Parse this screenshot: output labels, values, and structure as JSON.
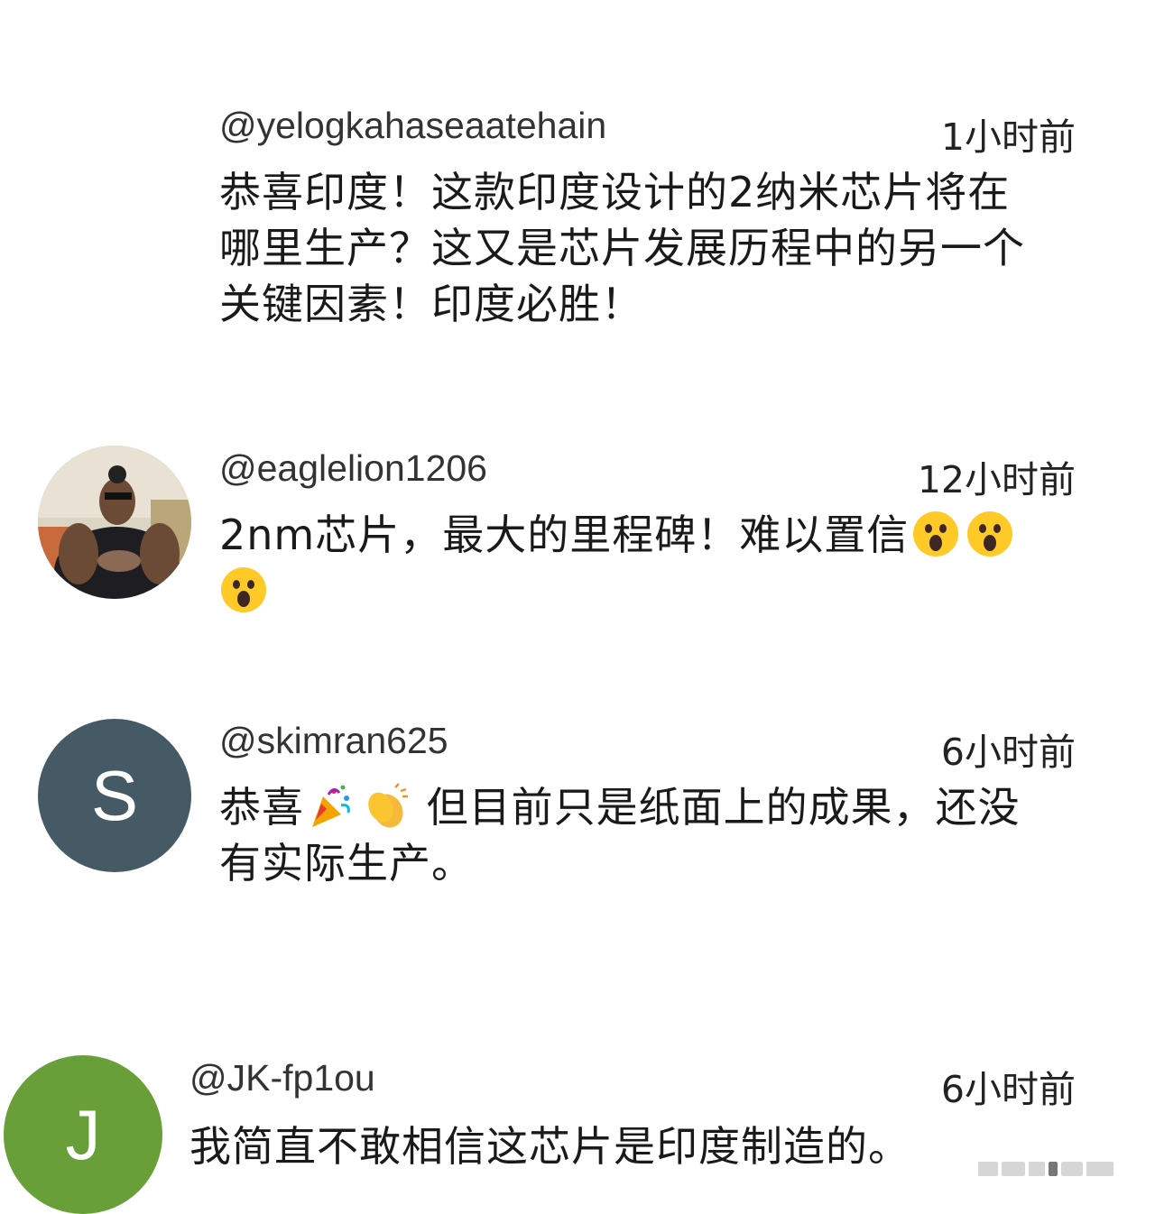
{
  "comments": [
    {
      "handle": "@yelogkahaseaatehain",
      "time": "1小时前",
      "line1": "恭喜印度！这款印度设计的2纳米芯片将在",
      "line2": "哪里生产？这又是芯片发展历程中的另一个",
      "line3": "关键因素！印度必胜！"
    },
    {
      "handle": "@eaglelion1206",
      "time": "12小时前",
      "text": "2nm芯片，最大的里程碑！难以置信",
      "emoji": "astonished-face"
    },
    {
      "handle": "@skimran625",
      "avatar_letter": "S",
      "avatar_color": "#455a64",
      "time": "6小时前",
      "text_a": "恭喜",
      "text_b": "但目前只是纸面上的成果，还没",
      "line2": "有实际生产。",
      "emojis": [
        "party-popper",
        "clapping-hands"
      ]
    },
    {
      "handle": "@JK-fp1ou",
      "avatar_letter": "J",
      "avatar_color": "#689f38",
      "time": "6小时前",
      "text": "我简直不敢相信这芯片是印度制造的。"
    }
  ]
}
